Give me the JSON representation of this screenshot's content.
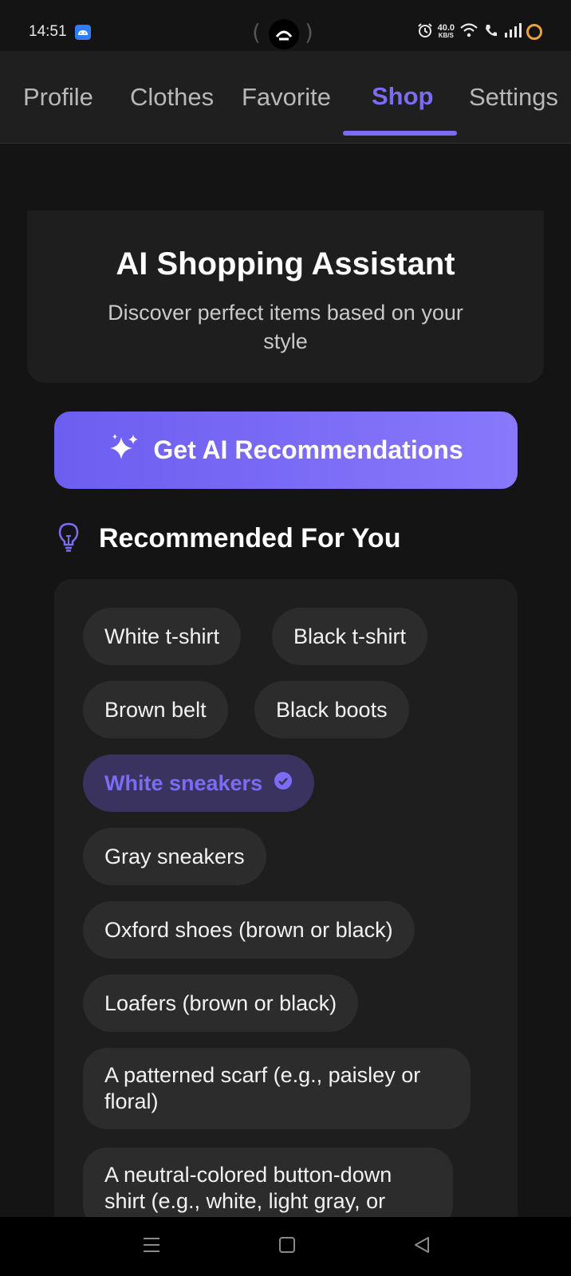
{
  "status_bar": {
    "time": "14:51",
    "net_speed_value": "40.0",
    "net_speed_unit": "KB/S",
    "icons": [
      "android-app-icon",
      "alarm-icon",
      "wifi-icon",
      "wifi-call-icon",
      "signal-icon",
      "battery-ring-icon"
    ],
    "battery_ring_color": "#e8a33a"
  },
  "tabs": {
    "items": [
      {
        "label": "Profile"
      },
      {
        "label": "Clothes"
      },
      {
        "label": "Favorite"
      },
      {
        "label": "Shop"
      },
      {
        "label": "Settings"
      }
    ],
    "active": "Shop",
    "accent_color": "#7b6cf6"
  },
  "hero": {
    "title": "AI Shopping Assistant",
    "subtitle": "Discover perfect items based on your style"
  },
  "ai_button": {
    "label": "Get AI Recommendations",
    "icon": "sparkles-icon",
    "gradient": [
      "#6c5ef0",
      "#8878fb"
    ]
  },
  "recommendations": {
    "heading": "Recommended For You",
    "icon": "lightbulb-icon",
    "items": [
      {
        "label": "White t-shirt",
        "selected": false
      },
      {
        "label": "Black t-shirt",
        "selected": false
      },
      {
        "label": "Brown belt",
        "selected": false
      },
      {
        "label": "Black boots",
        "selected": false
      },
      {
        "label": "White sneakers",
        "selected": true
      },
      {
        "label": "Gray sneakers",
        "selected": false
      },
      {
        "label": "Oxford shoes (brown or black)",
        "selected": false
      },
      {
        "label": "Loafers (brown or black)",
        "selected": false
      },
      {
        "label": "A patterned scarf (e.g., paisley or floral)",
        "selected": false
      },
      {
        "label": "A neutral-colored button-down shirt (e.g., white, light gray, or",
        "selected": false
      }
    ]
  },
  "nav_bar": {
    "buttons": [
      "menu-icon",
      "home-square-icon",
      "back-triangle-icon"
    ]
  }
}
